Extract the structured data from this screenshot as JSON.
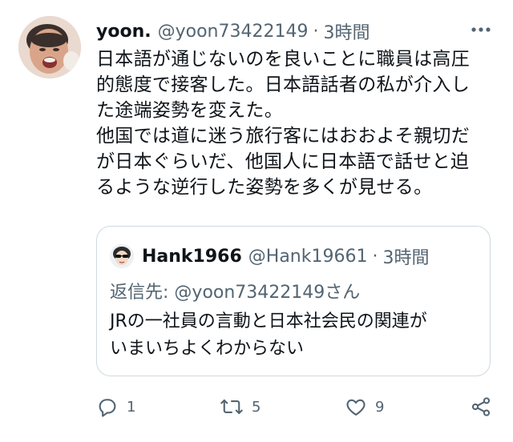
{
  "tweet": {
    "display_name": "yoon.",
    "handle": "@yoon73422149",
    "separator": "·",
    "time": "3時間",
    "more_icon": "more-dots-icon",
    "body_lines": [
      "日本語が通じないのを良いことに職員は高圧",
      "的態度で接客した。日本語話者の私が介入し",
      "た途端姿勢を変えた。",
      "他国では道に迷う旅行客にはおおよそ親切だ",
      "が日本ぐらいだ、他国人に日本語で話せと迫",
      "るような逆行した姿勢を多くが見せる。"
    ]
  },
  "quote": {
    "display_name": "Hank1966",
    "handle": "@Hank19661",
    "separator": "·",
    "time": "3時間",
    "reply_prefix": "返信先:",
    "reply_mention": "@yoon73422149さん",
    "text_lines": [
      "JRの一社員の言動と日本社会民の関連が",
      "いまいちよくわからない"
    ]
  },
  "actions": {
    "reply": {
      "icon": "reply-icon",
      "count": "1"
    },
    "retweet": {
      "icon": "retweet-icon",
      "count": "5"
    },
    "like": {
      "icon": "heart-icon",
      "count": "9"
    },
    "share": {
      "icon": "share-icon"
    }
  },
  "colors": {
    "text": "#0f1419",
    "secondary": "#536471",
    "border": "#cfd9de"
  }
}
